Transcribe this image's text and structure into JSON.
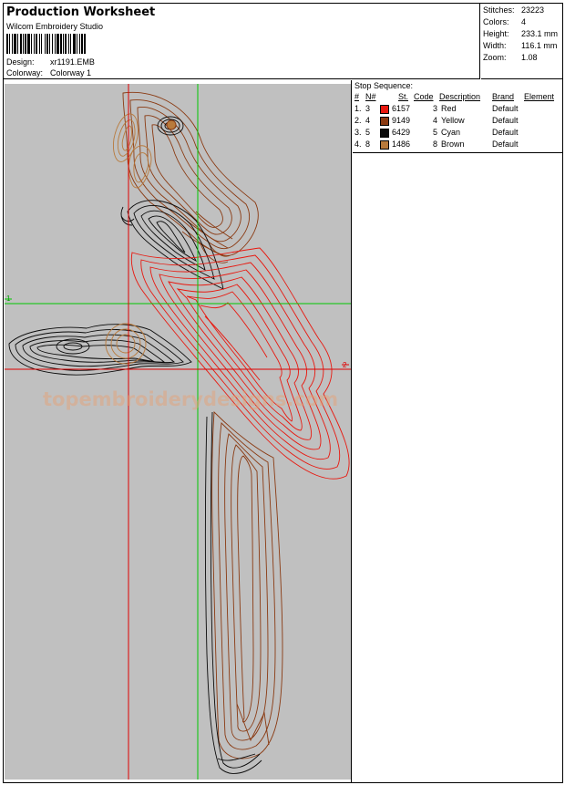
{
  "header": {
    "title": "Production Worksheet",
    "product": "Wilcom Embroidery Studio",
    "design_label": "Design:",
    "design_value": "xr1191.EMB",
    "colorway_label": "Colorway:",
    "colorway_value": "Colorway 1"
  },
  "stats": {
    "stitches_label": "Stitches:",
    "stitches_value": "23223",
    "colors_label": "Colors:",
    "colors_value": "4",
    "height_label": "Height:",
    "height_value": "233.1 mm",
    "width_label": "Width:",
    "width_value": "116.1 mm",
    "zoom_label": "Zoom:",
    "zoom_value": "1.08"
  },
  "stop_sequence": {
    "title": "Stop Sequence:",
    "headers": [
      "#",
      "N#",
      "St.",
      "Code",
      "Description",
      "Brand",
      "Element"
    ],
    "rows": [
      {
        "idx": "1.",
        "n": "3",
        "code_num": "6157",
        "st": "3",
        "desc": "Red",
        "brand": "Default",
        "color": "#e8180f"
      },
      {
        "idx": "2.",
        "n": "4",
        "code_num": "9149",
        "st": "4",
        "desc": "Yellow",
        "brand": "Default",
        "color": "#8a3a12"
      },
      {
        "idx": "3.",
        "n": "5",
        "code_num": "6429",
        "st": "5",
        "desc": "Cyan",
        "brand": "Default",
        "color": "#0a0a0a"
      },
      {
        "idx": "4.",
        "n": "8",
        "code_num": "1486",
        "st": "8",
        "desc": "Brown",
        "brand": "Default",
        "color": "#b87a3c"
      }
    ]
  },
  "canvas": {
    "watermark": "topembroiderydesigns.com",
    "marker_1": "1",
    "marker_2": "2",
    "colors": {
      "background": "#c0c0c0",
      "red": "#e8180f",
      "brown": "#8a3a12",
      "black": "#0a0a0a",
      "tan": "#b87a3c",
      "guide_green": "#00c800",
      "guide_red": "#e00000"
    }
  }
}
